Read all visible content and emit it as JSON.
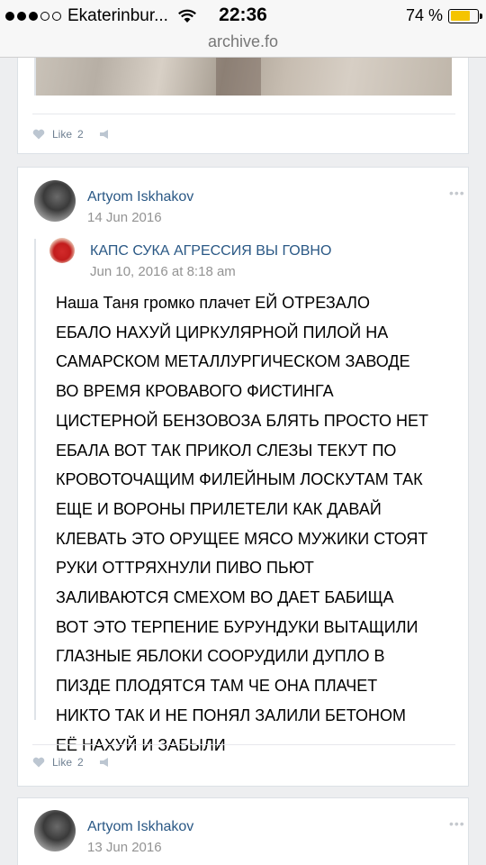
{
  "status_bar": {
    "carrier": "Ekaterinbur...",
    "time": "22:36",
    "battery_percent": "74 %",
    "battery_level": 0.74
  },
  "browser": {
    "url": "archive.fo"
  },
  "top_post": {
    "like_label": "Like",
    "like_count": "2"
  },
  "post": {
    "author": "Artyom Iskhakov",
    "date": "14 Jun 2016",
    "more": "•••",
    "repost": {
      "author": "КАПС СУКА АГРЕССИЯ ВЫ ГОВНО",
      "date": "Jun 10, 2016 at 8:18 am"
    },
    "text": "Наша Таня громко плачет ЕЙ ОТРЕЗАЛО\nЕБАЛО НАХУЙ ЦИРКУЛЯРНОЙ ПИЛОЙ НА\nСАМАРСКОМ МЕТАЛЛУРГИЧЕСКОМ ЗАВОДЕ\nВО ВРЕМЯ КРОВАВОГО ФИСТИНГА\nЦИСТЕРНОЙ БЕНЗОВОЗА БЛЯТЬ ПРОСТО НЕТ\nЕБАЛА ВОТ ТАК ПРИКОЛ СЛЕЗЫ ТЕКУТ ПО\nКРОВОТОЧАЩИМ ФИЛЕЙНЫМ ЛОСКУТАМ ТАК\nЕЩЕ И ВОРОНЫ ПРИЛЕТЕЛИ КАК ДАВАЙ\nКЛЕВАТЬ ЭТО ОРУЩЕЕ МЯСО МУЖИКИ СТОЯТ\nРУКИ ОТТРЯХНУЛИ ПИВО ПЬЮТ\nЗАЛИВАЮТСЯ СМЕХОМ ВО ДАЕТ БАБИЩА\nВОТ ЭТО ТЕРПЕНИЕ БУРУНДУКИ ВЫТАЩИЛИ\nГЛАЗНЫЕ ЯБЛОКИ СООРУДИЛИ ДУПЛО В\nПИЗДЕ ПЛОДЯТСЯ ТАМ ЧЕ ОНА ПЛАЧЕТ\nНИКТО ТАК И НЕ ПОНЯЛ ЗАЛИЛИ БЕТОНОМ\nЕЁ НАХУЙ И ЗАБЫЛИ",
    "like_label": "Like",
    "like_count": "2"
  },
  "next_post": {
    "author": "Artyom Iskhakov",
    "date": "13 Jun 2016",
    "more": "•••"
  },
  "colors": {
    "link": "#2a5885",
    "meta": "#939393",
    "background": "#edeef0",
    "battery": "#f5c400"
  }
}
